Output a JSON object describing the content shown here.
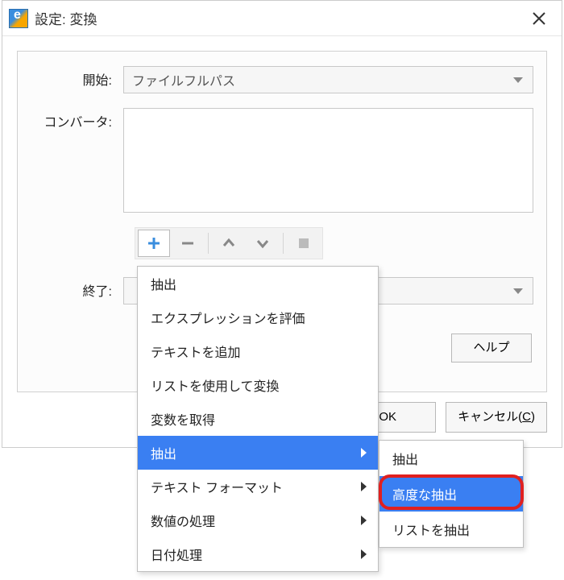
{
  "window": {
    "title": "設定: 変換"
  },
  "form": {
    "start_label": "開始:",
    "start_value": "ファイルフルパス",
    "converter_label": "コンバータ:",
    "end_label": "終了:",
    "end_value": ""
  },
  "toolbar_icons": {
    "add": "plus-icon",
    "remove": "minus-icon",
    "up": "chevron-up-icon",
    "down": "chevron-down-icon",
    "edit": "edit-icon"
  },
  "buttons": {
    "help": "ヘルプ",
    "ok": "OK",
    "cancel_prefix": "キャンセル(",
    "cancel_key": "C",
    "cancel_suffix": ")"
  },
  "menu": {
    "items": [
      {
        "label": "抽出",
        "sub": false
      },
      {
        "label": "エクスプレッションを評価",
        "sub": false
      },
      {
        "label": "テキストを追加",
        "sub": false
      },
      {
        "label": "リストを使用して変換",
        "sub": false
      },
      {
        "label": "変数を取得",
        "sub": false
      },
      {
        "label": "抽出",
        "sub": true,
        "highlight": true
      },
      {
        "label": "テキスト フォーマット",
        "sub": true
      },
      {
        "label": "数値の処理",
        "sub": true
      },
      {
        "label": "日付処理",
        "sub": true
      }
    ]
  },
  "submenu": {
    "items": [
      {
        "label": "抽出"
      },
      {
        "label": "高度な抽出",
        "highlight": true
      },
      {
        "label": "リストを抽出"
      }
    ]
  }
}
